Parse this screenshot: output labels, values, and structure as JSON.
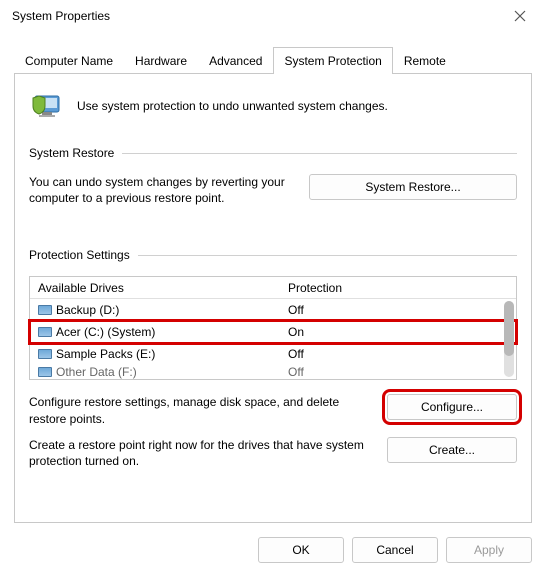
{
  "window": {
    "title": "System Properties"
  },
  "tabs": {
    "computer_name": "Computer Name",
    "hardware": "Hardware",
    "advanced": "Advanced",
    "system_protection": "System Protection",
    "remote": "Remote"
  },
  "intro": "Use system protection to undo unwanted system changes.",
  "sections": {
    "system_restore": {
      "title": "System Restore",
      "desc": "You can undo system changes by reverting your computer to a previous restore point.",
      "button": "System Restore..."
    },
    "protection_settings": {
      "title": "Protection Settings",
      "headers": {
        "drives": "Available Drives",
        "protection": "Protection"
      },
      "rows": [
        {
          "name": "Backup (D:)",
          "protection": "Off"
        },
        {
          "name": "Acer (C:) (System)",
          "protection": "On"
        },
        {
          "name": "Sample Packs (E:)",
          "protection": "Off"
        },
        {
          "name": "Other Data (F:)",
          "protection": "Off"
        }
      ],
      "configure_desc": "Configure restore settings, manage disk space, and delete restore points.",
      "configure_button": "Configure...",
      "create_desc": "Create a restore point right now for the drives that have system protection turned on.",
      "create_button": "Create..."
    }
  },
  "footer": {
    "ok": "OK",
    "cancel": "Cancel",
    "apply": "Apply"
  }
}
